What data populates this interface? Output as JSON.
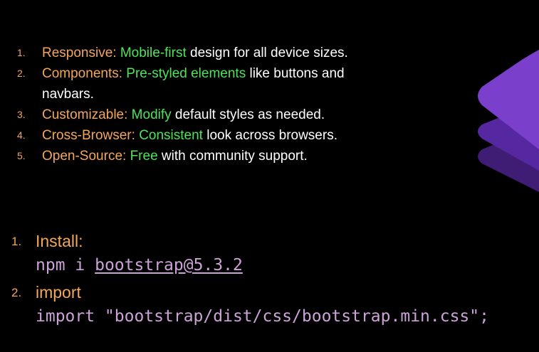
{
  "features": [
    {
      "num": "1.",
      "label": "Responsive:",
      "highlight": "Mobile-first",
      "rest": " design for all device sizes."
    },
    {
      "num": "2.",
      "label": "Components:",
      "highlight": "Pre-styled elements",
      "rest": " like buttons and navbars."
    },
    {
      "num": "3.",
      "label": "Customizable:",
      "highlight": "Modify",
      "rest": " default styles as needed."
    },
    {
      "num": "4.",
      "label": "Cross-Browser:",
      "highlight": "Consistent",
      "rest": " look across browsers."
    },
    {
      "num": "5.",
      "label": "Open-Source:",
      "highlight": "Free",
      "rest": " with community support."
    }
  ],
  "steps": [
    {
      "num": "1.",
      "title": "Install:",
      "code_prefix": "npm i ",
      "code_pkg": "bootstrap@5.3.2",
      "code_suffix": ""
    },
    {
      "num": "2.",
      "title": "import",
      "code_prefix": "import \"bootstrap/dist/css/bootstrap.min.css\";",
      "code_pkg": "",
      "code_suffix": ""
    }
  ],
  "colors": {
    "background": "#000000",
    "label": "#f4a65b",
    "highlight": "#4de35a",
    "code": "#cda2d8",
    "deco_top": "#7b3fc4",
    "deco_mid": "#5a2a9e",
    "deco_bottom": "#43207a"
  }
}
